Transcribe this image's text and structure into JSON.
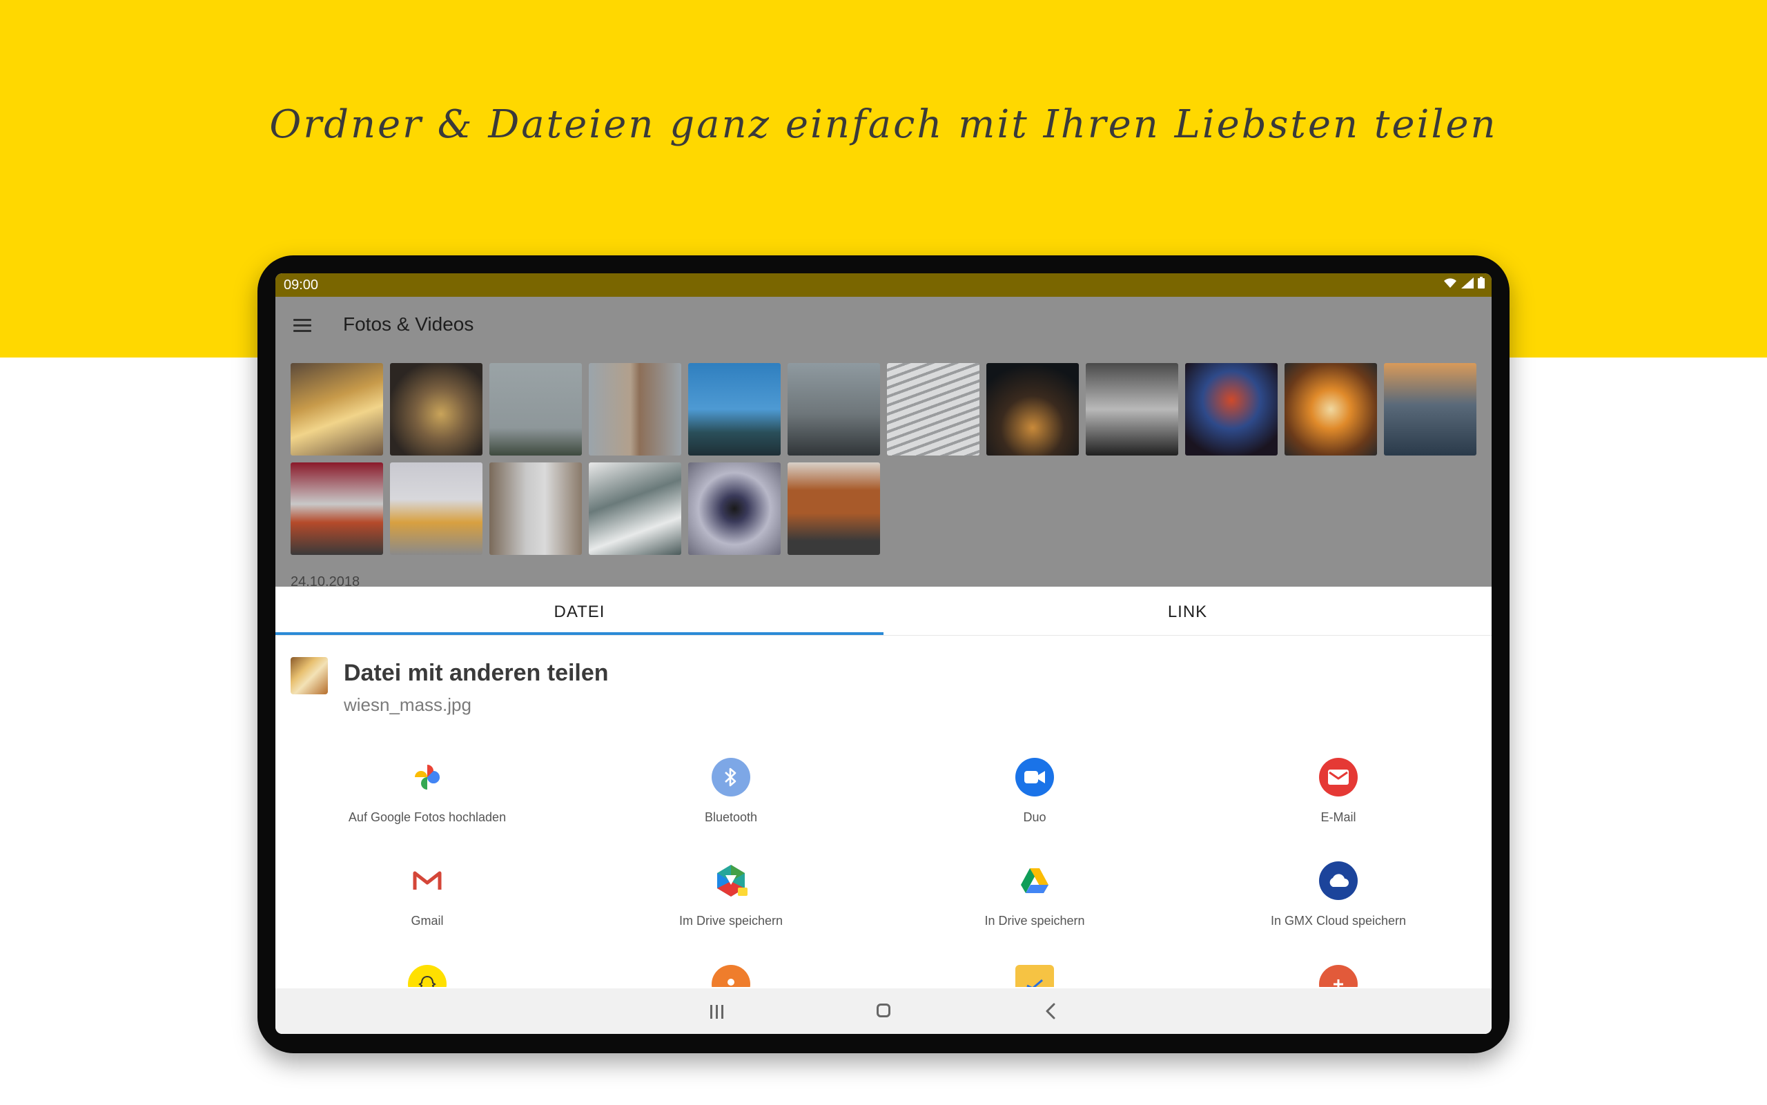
{
  "hero": {
    "title": "Ordner & Dateien ganz einfach mit Ihren Liebsten teilen"
  },
  "status_bar": {
    "time": "09:00"
  },
  "app_bar": {
    "title": "Fotos & Videos"
  },
  "gallery": {
    "date_label": "24.10.2018"
  },
  "share_sheet": {
    "tabs": [
      {
        "label": "DATEI",
        "selected": true
      },
      {
        "label": "LINK",
        "selected": false
      }
    ],
    "title": "Datei mit anderen teilen",
    "filename": "wiesn_mass.jpg",
    "targets": [
      {
        "label": "Auf Google Fotos hochladen",
        "icon": "google-photos-icon"
      },
      {
        "label": "Bluetooth",
        "icon": "bluetooth-icon"
      },
      {
        "label": "Duo",
        "icon": "duo-icon"
      },
      {
        "label": "E-Mail",
        "icon": "email-icon"
      },
      {
        "label": "Gmail",
        "icon": "gmail-icon"
      },
      {
        "label": "Im Drive speichern",
        "icon": "drive-hex-icon"
      },
      {
        "label": "In Drive speichern",
        "icon": "google-drive-icon"
      },
      {
        "label": "In GMX Cloud speichern",
        "icon": "gmx-cloud-icon"
      }
    ]
  },
  "colors": {
    "brand_yellow": "#ffd800",
    "accent_blue": "#2b8ad6"
  }
}
